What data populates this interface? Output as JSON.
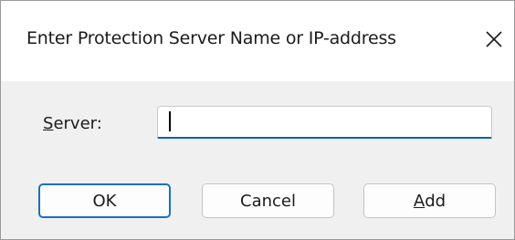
{
  "dialog": {
    "title": "Enter Protection Server Name or IP-address",
    "close_icon": "close-icon"
  },
  "form": {
    "server_label_mnemonic": "S",
    "server_label_rest": "erver:",
    "server_value": ""
  },
  "buttons": {
    "ok_label": "OK",
    "cancel_label": "Cancel",
    "add_label_mnemonic": "A",
    "add_label_rest": "dd"
  },
  "colors": {
    "accent": "#0063b1",
    "default_button_border": "#1a6fc3",
    "dialog_background": "#f0f0f0"
  }
}
